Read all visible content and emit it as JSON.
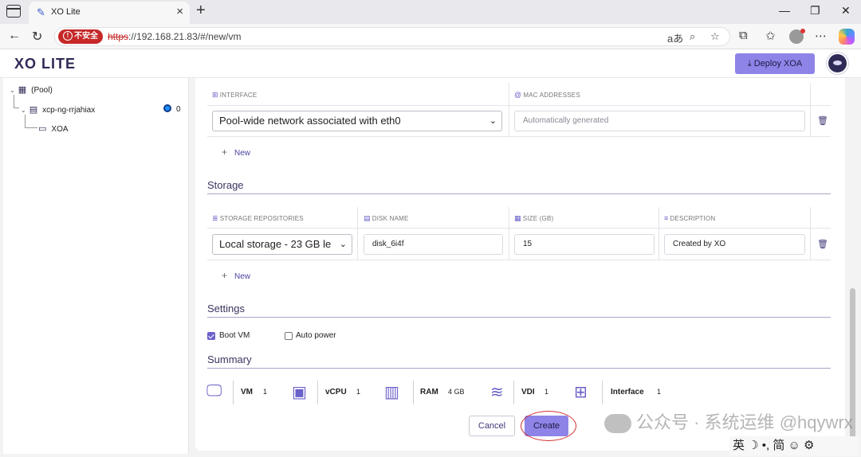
{
  "browser": {
    "tab_title": "XO Lite",
    "insecure_label": "不安全",
    "url_proto": "https",
    "url_rest": "://192.168.21.83/#/new/vm"
  },
  "app": {
    "logo": "XO LITE",
    "deploy_label": "Deploy XOA",
    "accent_color": "#8e84e8"
  },
  "sidebar": {
    "pool": "(Pool)",
    "host": "xcp-ng-rrjahiax",
    "host_vm_count": "0",
    "vm": "XOA"
  },
  "network": {
    "interface_header": "INTERFACE",
    "mac_header": "MAC ADDRESSES",
    "interface_value": "Pool-wide network associated with eth0",
    "mac_placeholder": "Automatically generated",
    "new_label": "New"
  },
  "storage": {
    "title": "Storage",
    "sr_header": "STORAGE REPOSITORIES",
    "disk_header": "DISK NAME",
    "size_header": "SIZE (GB)",
    "desc_header": "DESCRIPTION",
    "sr_value": "Local storage - 23 GB le",
    "disk_value": "disk_6i4f",
    "size_value": "15",
    "desc_value": "Created by XO",
    "new_label": "New"
  },
  "settings": {
    "title": "Settings",
    "boot_vm": "Boot VM",
    "boot_vm_checked": true,
    "auto_power": "Auto power",
    "auto_power_checked": false
  },
  "summary": {
    "title": "Summary",
    "vm_label": "VM",
    "vm_value": "1",
    "vcpu_label": "vCPU",
    "vcpu_value": "1",
    "ram_label": "RAM",
    "ram_value": "4 GB",
    "vdi_label": "VDI",
    "vdi_value": "1",
    "interface_label": "Interface",
    "interface_value": "1"
  },
  "actions": {
    "cancel": "Cancel",
    "create": "Create"
  },
  "overlay": {
    "watermark": "公众号 · 系统运维",
    "watermark_handle": "@hqywrx",
    "ime": "英 ☽ •, 简 ☺ ⚙"
  }
}
